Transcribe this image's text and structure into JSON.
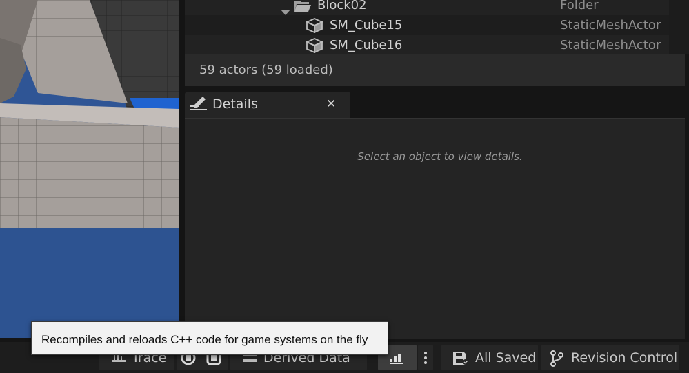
{
  "outliner": {
    "rows": [
      {
        "label": "Block02",
        "type": "Folder",
        "icon": "folder-open-icon"
      },
      {
        "label": "SM_Cube15",
        "type": "StaticMeshActor",
        "icon": "static-mesh-icon"
      },
      {
        "label": "SM_Cube16",
        "type": "StaticMeshActor",
        "icon": "static-mesh-icon"
      }
    ],
    "status": "59 actors (59 loaded)"
  },
  "details": {
    "tab_label": "Details",
    "close_glyph": "✕",
    "empty_message": "Select an object to view details."
  },
  "bottom_bar": {
    "trace_label": "Trace",
    "derived_data_label": "Derived Data",
    "saved_label": "All Saved",
    "revision_control_label": "Revision Control"
  },
  "tooltip": {
    "text": "Recompiles and reloads C++ code for game systems on the fly"
  },
  "colors": {
    "viewport_blue": "#2f5595",
    "panel_bg": "#242424",
    "tooltip_bg": "#f2f2f2"
  }
}
